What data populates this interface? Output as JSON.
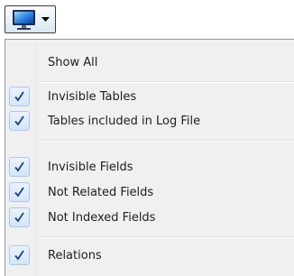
{
  "toolbar": {
    "button_icon": "monitor-icon",
    "dropdown_icon": "chevron-down-icon"
  },
  "menu": {
    "items": [
      {
        "label": "Show All",
        "checked": false
      },
      {
        "label": "Invisible Tables",
        "checked": true
      },
      {
        "label": "Tables included in Log File",
        "checked": true
      },
      {
        "label": "Invisible Fields",
        "checked": true
      },
      {
        "label": "Not Related Fields",
        "checked": true
      },
      {
        "label": "Not Indexed Fields",
        "checked": true
      },
      {
        "label": "Relations",
        "checked": true
      }
    ]
  },
  "colors": {
    "checkmark": "#15428b",
    "check_box_border": "#a8c9ef",
    "menu_background": "#f0f0f0"
  }
}
